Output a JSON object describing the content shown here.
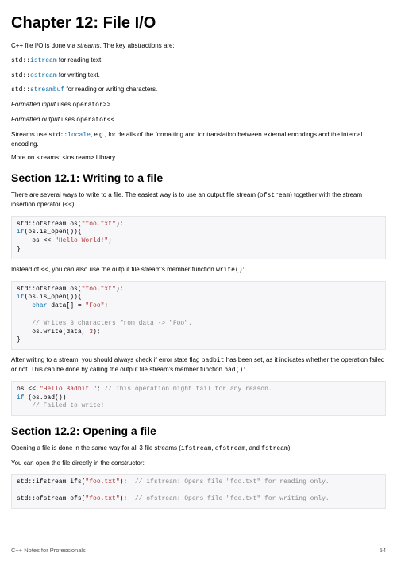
{
  "chapter_title": "Chapter 12: File I/O",
  "intro": {
    "lead_a": "C++ file I/O is done via ",
    "lead_em": "streams",
    "lead_b": ". The key abstractions are:",
    "istream_code": "std::istream",
    "istream_txt": " for reading text.",
    "ostream_code": "std::ostream",
    "ostream_txt": " for writing text.",
    "streambuf_code": "std::streambuf",
    "streambuf_txt": " for reading or writing characters.",
    "fin_em": "Formatted input",
    "fin_uses": " uses ",
    "fin_code": "operator>>",
    "dot": ".",
    "fout_em": "Formatted output",
    "fout_uses": " uses ",
    "fout_code": "operator<<",
    "streams_a": "Streams use ",
    "streams_code": "std::locale",
    "streams_b": ", e.g., for details of the formatting and for translation between external encodings and the internal encoding.",
    "more": "More on streams: <iostream> Library"
  },
  "s1": {
    "title": "Section 12.1: Writing to a file",
    "p1_a": "There are several ways to write to a file. The easiest way is to use an output file stream (",
    "p1_code": "ofstream",
    "p1_b": ") together with the stream insertion operator (",
    "p1_op": "<<",
    "p1_c": "):",
    "code1_l1a": "std::ofstream os(",
    "code1_l1str": "\"foo.txt\"",
    "code1_l1b": ");",
    "code1_if": "if",
    "code1_l2": "(os.is_open()){",
    "code1_l3a": "    os << ",
    "code1_l3str": "\"Hello World!\"",
    "code1_l3b": ";",
    "code1_l4": "}",
    "p2_a": "Instead of ",
    "p2_op": "<<",
    "p2_b": ", you can also use the output file stream's member function ",
    "p2_code": "write()",
    "p2_c": ":",
    "code2_l1a": "std::ofstream os(",
    "code2_l1str": "\"foo.txt\"",
    "code2_l1b": ");",
    "code2_l2": "(os.is_open()){",
    "code2_char": "char",
    "code2_l3a": " data[] = ",
    "code2_l3str": "\"Foo\"",
    "code2_l3b": ";",
    "code2_cmt": "// Writes 3 characters from data -> \"Foo\".",
    "code2_l5a": "    os.write(data, ",
    "code2_l5num": "3",
    "code2_l5b": ");",
    "code2_l6": "}",
    "p3_a": "After writing to a stream, you should always check if error state flag ",
    "p3_code1": "badbit",
    "p3_b": " has been set, as it indicates whether the operation failed or not. This can be done by calling the output file stream's member function ",
    "p3_code2": "bad()",
    "p3_c": ":",
    "code3_l1a": "os << ",
    "code3_l1str": "\"Hello Badbit!\"",
    "code3_l1b": "; ",
    "code3_l1cmt": "// This operation might fail for any reason.",
    "code3_l2": " (os.bad())",
    "code3_l3cmt": "// Failed to write!"
  },
  "s2": {
    "title": "Section 12.2: Opening a file",
    "p1_a": "Opening a file is done in the same way for all 3 file streams (",
    "p1_c1": "ifstream",
    "p1_sep": ", ",
    "p1_c2": "ofstream",
    "p1_and": ", and ",
    "p1_c3": "fstream",
    "p1_b": ").",
    "p2": "You can open the file directly in the constructor:",
    "code1_l1a": "std::ifstream ifs(",
    "code1_l1str": "\"foo.txt\"",
    "code1_l1b": ");  ",
    "code1_l1cmt": "// ifstream: Opens file \"foo.txt\" for reading only.",
    "code1_l2a": "std::ofstream ofs(",
    "code1_l2str": "\"foo.txt\"",
    "code1_l2b": ");  ",
    "code1_l2cmt": "// ofstream: Opens file \"foo.txt\" for writing only."
  },
  "footer": {
    "left": "C++ Notes for Professionals",
    "right": "54"
  }
}
